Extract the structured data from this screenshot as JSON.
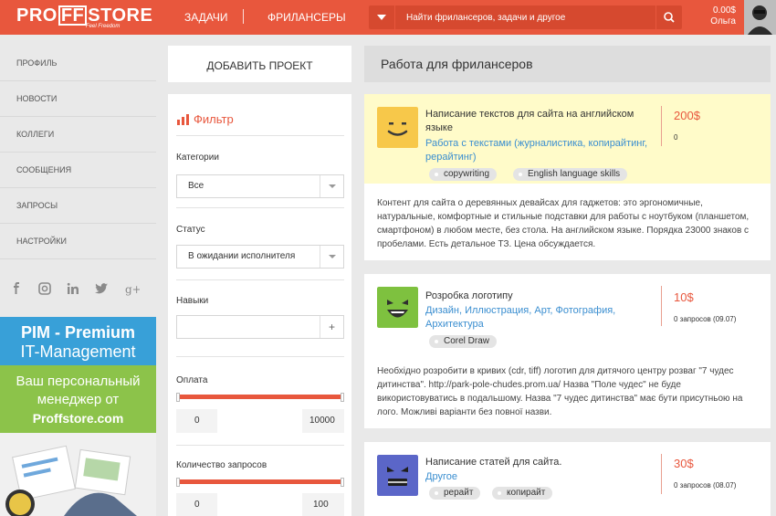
{
  "header": {
    "logo_a": "PRO",
    "logo_b": "FF",
    "logo_c": "STORE",
    "logo_sub": "Feel Freedom",
    "nav_tasks": "ЗАДАЧИ",
    "nav_freelancers": "ФРИЛАНСЕРЫ",
    "search_placeholder": "Найти фрилансеров, задачи и другое",
    "balance": "0.00$",
    "user_name": "Ольга"
  },
  "sidebar": {
    "items": [
      {
        "label": "ПРОФИЛЬ"
      },
      {
        "label": "НОВОСТИ"
      },
      {
        "label": "КОЛЛЕГИ"
      },
      {
        "label": "СООБЩЕНИЯ"
      },
      {
        "label": "ЗАПРОСЫ"
      },
      {
        "label": "НАСТРОЙКИ"
      }
    ],
    "social": [
      "facebook-icon",
      "instagram-icon",
      "linkedin-icon",
      "twitter-icon",
      "google-plus-icon"
    ]
  },
  "banner": {
    "line1": "PIM - Premium",
    "line2": "IT-Management",
    "line3": "Ваш персональный",
    "line4": "менеджер от",
    "line5": "Proffstore.com"
  },
  "add_project": "ДОБАВИТЬ ПРОЕКТ",
  "filter": {
    "title": "Фильтр",
    "category_label": "Категории",
    "category_value": "Все",
    "status_label": "Статус",
    "status_value": "В ожидании исполнителя",
    "skills_label": "Навыки",
    "skills_add": "+",
    "payment_label": "Оплата",
    "payment_min": "0",
    "payment_max": "10000",
    "requests_label": "Количество запросов",
    "requests_min": "0",
    "requests_max": "100"
  },
  "jobs": {
    "heading": "Работа для фрилансеров",
    "list": [
      {
        "title": "Написание текстов для сайта на английском языке",
        "categories": "Работа с текстами (журналистика, копирайтинг, рерайтинг)",
        "tags": [
          "copywriting",
          "English language skills"
        ],
        "price": "200$",
        "requests": "0",
        "description": "Контент для сайта о деревянных девайсах для гаджетов: это эргономичные, натуральные, комфортные и стильные подставки для работы с ноутбуком (планшетом, смартфоном) в любом месте, без стола. На английском языке. Порядка 23000 знаков с пробелами. Есть детальное ТЗ. Цена обсуждается."
      },
      {
        "title": "Розробка логотипу",
        "categories": "Дизайн, Иллюстрация, Арт, Фотография, Архитектура",
        "tags": [
          "Corel Draw"
        ],
        "price": "10$",
        "requests": "0 запросов (09.07)",
        "description": "Необхідно розробити в кривих (cdr, tiff) логотип для дитячого центру розваг \"7 чудес дитинства\". http://park-pole-chudes.prom.ua/ Назва \"Поле чудес\" не буде використовуватись в подальшому. Назва \"7 чудес дитинства\" має бути присутньою на лого. Можливі варіанти без повної назви."
      },
      {
        "title": "Написание статей для сайта.",
        "categories": "Другое",
        "tags": [
          "рерайт",
          "копирайт"
        ],
        "price": "30$",
        "requests": "0 запросов (08.07)"
      }
    ]
  },
  "colors": {
    "accent": "#e8573d",
    "link": "#3a8ed0",
    "highlight": "#fffbc9"
  }
}
